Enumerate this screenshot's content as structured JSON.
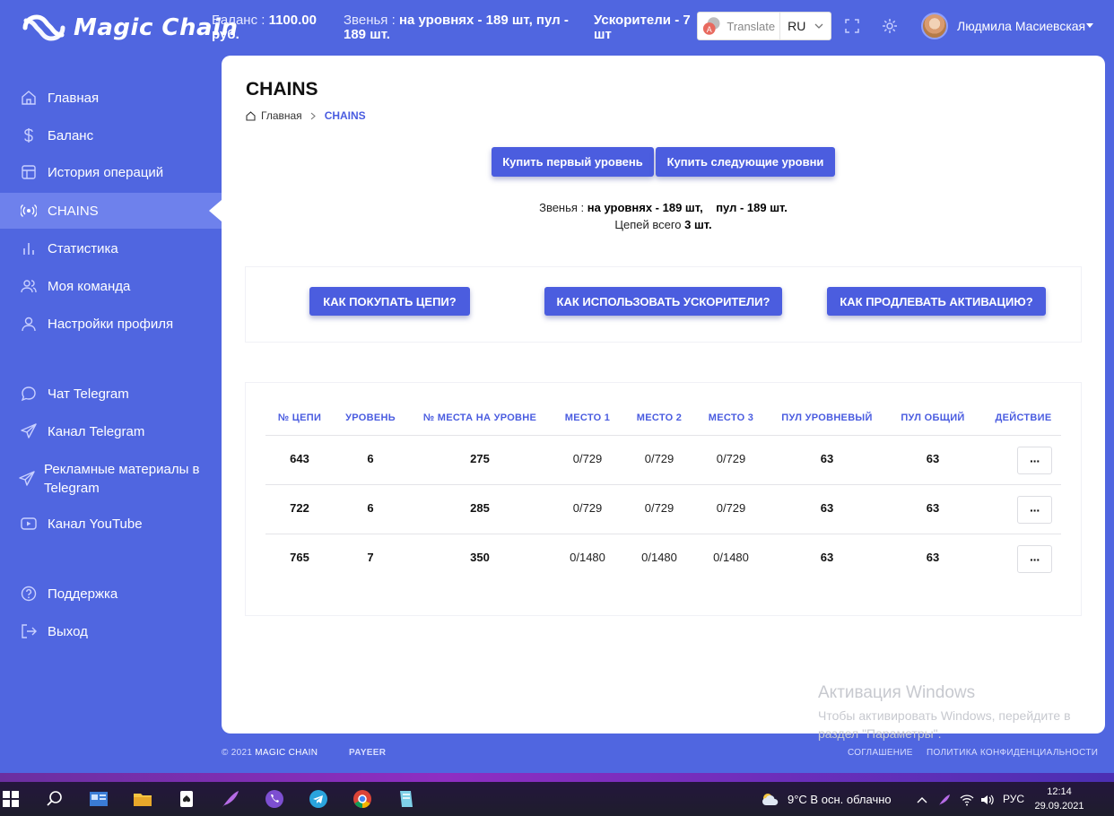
{
  "header": {
    "logo_text": "Magic Chain",
    "balance_label": "Баланс : ",
    "balance_value": "1100.00 руб.",
    "links_label": "Звенья : ",
    "links_value": "на уровнях - 189 шт,    пул - 189 шт.",
    "boosters_label": "Ускорители - 7 шт",
    "translate_label": "Translate",
    "language": "RU",
    "user_name": "Людмила Масиевская"
  },
  "sidebar": {
    "items": [
      {
        "label": "Главная",
        "icon": "home-icon"
      },
      {
        "label": "Баланс",
        "icon": "dollar-icon"
      },
      {
        "label": "История операций",
        "icon": "history-icon"
      },
      {
        "label": "CHAINS",
        "icon": "broadcast-icon",
        "active": true
      },
      {
        "label": "Статистика",
        "icon": "bar-chart-icon"
      },
      {
        "label": "Моя команда",
        "icon": "team-icon"
      },
      {
        "label": "Настройки профиля",
        "icon": "user-icon"
      },
      {
        "label": "Чат Telegram",
        "icon": "chat-icon"
      },
      {
        "label": "Канал Telegram",
        "icon": "send-icon"
      },
      {
        "label": "Рекламные материалы в Telegram",
        "icon": "send-icon"
      },
      {
        "label": "Канал YouTube",
        "icon": "youtube-icon"
      },
      {
        "label": "Поддержка",
        "icon": "help-icon"
      },
      {
        "label": "Выход",
        "icon": "logout-icon"
      }
    ]
  },
  "page": {
    "title": "CHAINS",
    "breadcrumb_home": "Главная",
    "breadcrumb_current": "CHAINS",
    "buy_first_label": "Купить первый уровень",
    "buy_next_label": "Купить следующие уровни",
    "stats_links_label": "Звенья : ",
    "stats_links_levels": "на уровнях - 189 шт,",
    "stats_links_pool": "пул - 189 шт.",
    "stats_chains_label": "Цепей всего ",
    "stats_chains_value": "3 шт.",
    "help_buy_label": "КАК ПОКУПАТЬ ЦЕПИ?",
    "help_boost_label": "КАК ИСПОЛЬЗОВАТЬ УСКОРИТЕЛИ?",
    "help_extend_label": "КАК ПРОДЛЕВАТЬ АКТИВАЦИЮ?"
  },
  "table": {
    "columns": [
      "№ ЦЕПИ",
      "УРОВЕНЬ",
      "№ МЕСТА НА УРОВНЕ",
      "МЕСТО 1",
      "МЕСТО 2",
      "МЕСТО 3",
      "ПУЛ УРОВНЕВЫЙ",
      "ПУЛ ОБЩИЙ",
      "ДЕЙСТВИЕ"
    ],
    "rows": [
      [
        "643",
        "6",
        "275",
        "0/729",
        "0/729",
        "0/729",
        "63",
        "63"
      ],
      [
        "722",
        "6",
        "285",
        "0/729",
        "0/729",
        "0/729",
        "63",
        "63"
      ],
      [
        "765",
        "7",
        "350",
        "0/1480",
        "0/1480",
        "0/1480",
        "63",
        "63"
      ]
    ],
    "action_label": "···"
  },
  "watermark": {
    "title": "Активация Windows",
    "text": "Чтобы активировать Windows, перейдите в раздел \"Параметры\"."
  },
  "footer": {
    "copyright": "© 2021 ",
    "brand": "MAGIC CHAIN",
    "payeer": "PAYEER",
    "agreement": "СОГЛАШЕНИЕ",
    "privacy": "ПОЛИТИКА КОНФИДЕНЦИАЛЬНОСТИ"
  },
  "taskbar": {
    "weather": "9°C  В осн. облачно",
    "language": "РУС",
    "time": "12:14",
    "date": "29.09.2021"
  },
  "colors": {
    "primary": "#5066e0",
    "button": "#4b5ddf",
    "accent_text": "#4a5ce0"
  }
}
